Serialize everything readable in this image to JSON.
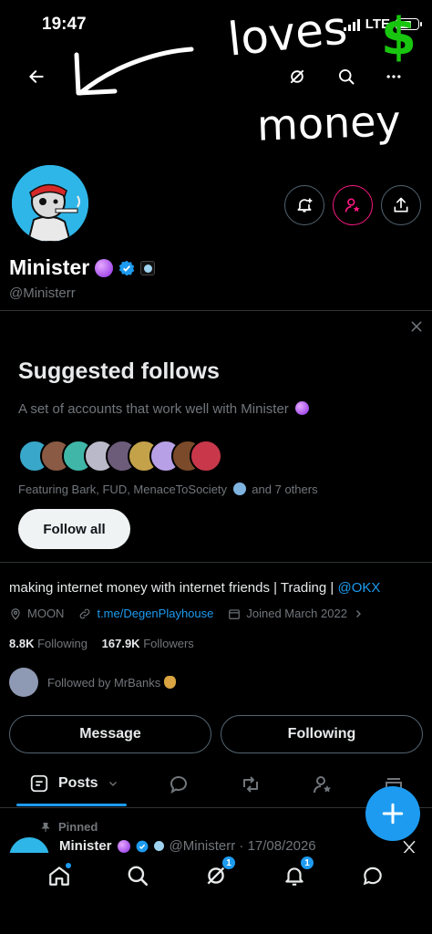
{
  "status_bar": {
    "time": "19:47",
    "network": "LTE"
  },
  "annotation": {
    "word1": "loves",
    "word2": "money",
    "symbol": "$"
  },
  "profile": {
    "name": "Minister",
    "handle": "@Ministerr",
    "bio_text": "making internet money with internet friends | Trading | ",
    "bio_link": "@OKX",
    "location": "MOON",
    "website": "t.me/DegenPlayhouse",
    "joined": "Joined March 2022",
    "following_count": "8.8K",
    "following_label": "Following",
    "followers_count": "167.9K",
    "followers_label": "Followers",
    "followed_by": "Followed by MrBanks"
  },
  "suggested": {
    "title": "Suggested follows",
    "description": "A set of accounts that work well with Minister",
    "featuring": "Featuring Bark, FUD, MenaceToSociety",
    "featuring_tail": "and 7 others",
    "follow_all": "Follow all"
  },
  "buttons": {
    "message": "Message",
    "following": "Following"
  },
  "tabs": {
    "posts": "Posts"
  },
  "pinned": {
    "label": "Pinned",
    "name": "Minister",
    "handle_date": "@Ministerr · 17/08/2026"
  },
  "nav": {
    "messages_badge": "1",
    "notifications_badge": "1"
  },
  "colors": {
    "accent": "#1d9bf0",
    "pink": "#f91880",
    "avatar_bg": "#2fb6e8"
  }
}
